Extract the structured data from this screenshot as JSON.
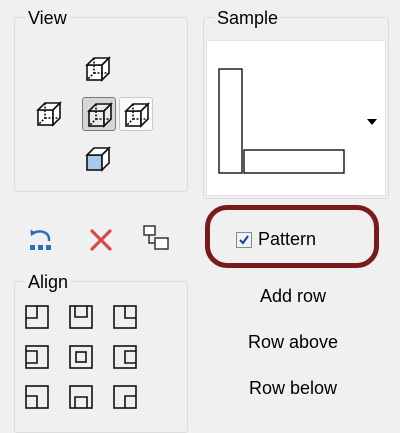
{
  "view": {
    "title": "View",
    "cubes": [
      {
        "name": "view-top-cube-icon"
      },
      {
        "name": "view-left-cube-icon"
      },
      {
        "name": "view-front-cube-icon",
        "state": "selected"
      },
      {
        "name": "view-right-cube-icon",
        "state": "hovered"
      },
      {
        "name": "view-bottom-cube-icon",
        "face_color": "#a8c8ec"
      }
    ]
  },
  "sample": {
    "title": "Sample",
    "dropdown_icon": "triangle-down-icon"
  },
  "toolbar": {
    "icons": [
      "insert-row-icon",
      "delete-x-icon",
      "hierarchy-icon"
    ],
    "delete_color": "#d64a4a",
    "insert_color": "#2a6fb8"
  },
  "pattern": {
    "label": "Pattern",
    "checked": true,
    "highlight_color": "#7a1a1a"
  },
  "align": {
    "title": "Align",
    "buttons": [
      "align-top-left-icon",
      "align-top-center-icon",
      "align-top-right-icon",
      "align-middle-left-icon",
      "align-center-icon",
      "align-middle-right-icon",
      "align-bottom-left-icon",
      "align-bottom-center-icon",
      "align-bottom-right-icon"
    ]
  },
  "rows": {
    "add_row": "Add row",
    "row_above": "Row above",
    "row_below": "Row below"
  }
}
